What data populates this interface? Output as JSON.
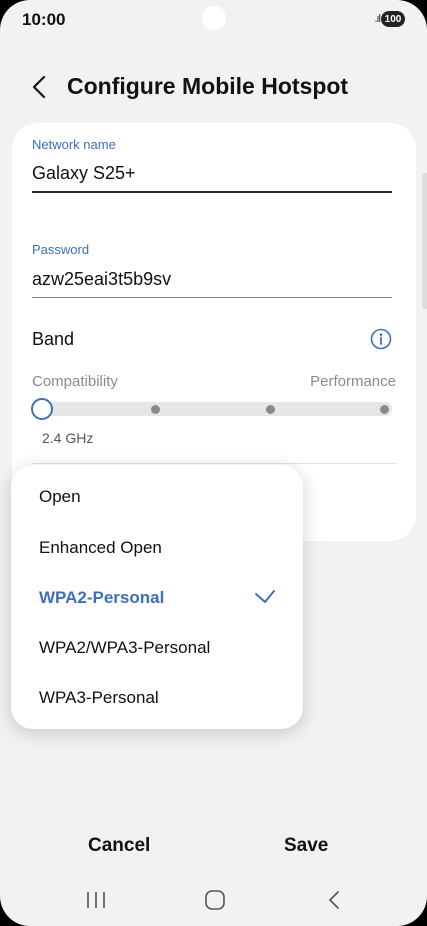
{
  "status_bar": {
    "time": "10:00",
    "signal": ".ıl",
    "battery": "100"
  },
  "header": {
    "title": "Configure Mobile Hotspot"
  },
  "network": {
    "label": "Network name",
    "value": "Galaxy S25+"
  },
  "password": {
    "label": "Password",
    "value": "azw25eai3t5b9sv"
  },
  "band": {
    "label": "Band",
    "left_label": "Compatibility",
    "right_label": "Performance",
    "selected_value": "2.4 GHz",
    "selected_position": 0,
    "positions": 4
  },
  "security_menu": {
    "items": [
      {
        "label": "Open",
        "selected": false
      },
      {
        "label": "Enhanced Open",
        "selected": false
      },
      {
        "label": "WPA2-Personal",
        "selected": true
      },
      {
        "label": "WPA2/WPA3-Personal",
        "selected": false
      },
      {
        "label": "WPA3-Personal",
        "selected": false
      }
    ]
  },
  "buttons": {
    "cancel": "Cancel",
    "save": "Save"
  },
  "colors": {
    "accent": "#3e6fba",
    "background": "#f2f2f4",
    "card": "#ffffff"
  }
}
